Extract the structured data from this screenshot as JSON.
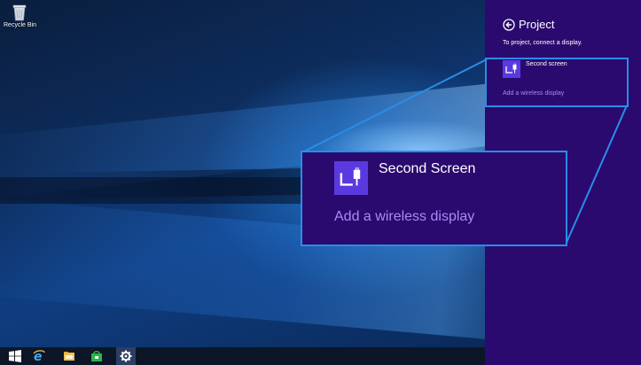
{
  "desktop": {
    "icons": [
      {
        "label": "Recycle Bin",
        "icon": "recycle-bin-icon"
      }
    ]
  },
  "taskbar": {
    "buttons": [
      {
        "icon": "windows-start-icon",
        "color": "#ffffff"
      },
      {
        "icon": "internet-explorer-icon",
        "color": "#3fa8f0"
      },
      {
        "icon": "file-explorer-icon",
        "color": "#f2c14e"
      },
      {
        "icon": "store-icon",
        "color": "#2fb24a"
      },
      {
        "icon": "settings-gear-icon",
        "color": "#ffffff",
        "active": true
      }
    ]
  },
  "project_panel": {
    "title": "Project",
    "subtitle": "To project, connect a display.",
    "display_name": "Second screen",
    "wireless_link": "Add a wireless display",
    "background": "#2a0a6e",
    "tile_color": "#5a3ae0",
    "link_color": "#a58cf5"
  },
  "zoom_callout": {
    "display_name": "Second Screen",
    "wireless_link": "Add a wireless display",
    "highlight_color": "#2a8de6"
  }
}
